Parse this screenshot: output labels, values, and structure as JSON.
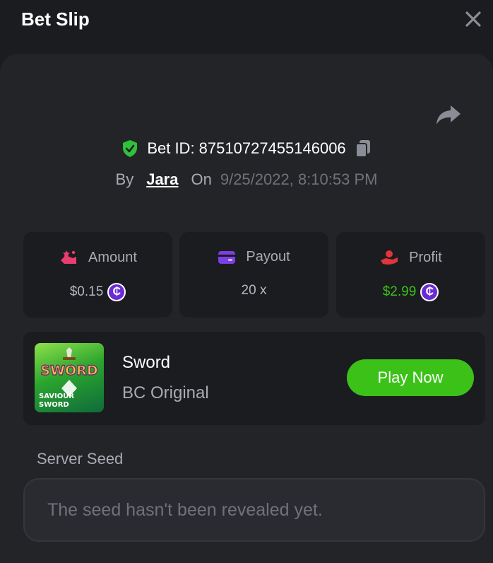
{
  "header": {
    "title": "Bet Slip",
    "close_icon": "close-icon"
  },
  "bet": {
    "id_text": "Bet ID: 87510727455146006",
    "by_label": "By",
    "user": "Jara",
    "on_label": "On",
    "date": "9/25/2022, 8:10:53 PM"
  },
  "stats": [
    {
      "label": "Amount",
      "value": "$0.15",
      "icon": "money-hand-icon",
      "color": "#e73e6f"
    },
    {
      "label": "Payout",
      "value": "20 x",
      "icon": "card-icon",
      "color": "#7b3fe4"
    },
    {
      "label": "Profit",
      "value": "$2.99",
      "icon": "hand-coin-icon",
      "color": "#e2343b"
    }
  ],
  "coin_symbol": "₵",
  "game": {
    "name": "Sword",
    "subtitle": "BC Original",
    "play_label": "Play Now",
    "thumb_title": "SWORD",
    "thumb_caption_1": "SAVIOUR",
    "thumb_caption_2": "SWORD"
  },
  "server_seed": {
    "label": "Server Seed",
    "value": "The seed hasn't been revealed yet."
  },
  "colors": {
    "accent_green": "#3bc117",
    "background": "#1b1c20",
    "panel": "#232428"
  }
}
